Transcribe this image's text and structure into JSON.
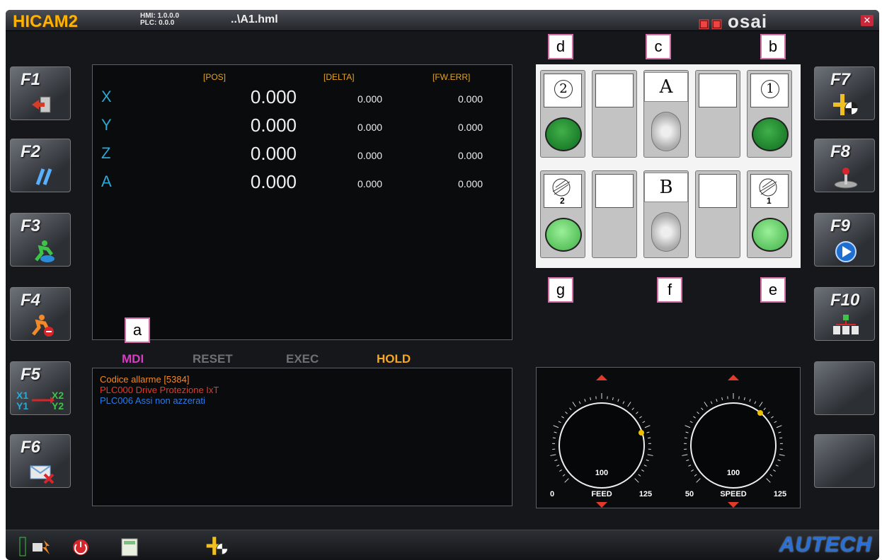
{
  "title_bar": {
    "logo": "HICAM2",
    "hmi_version": "HMI: 1.0.0.0",
    "plc_version": "PLC: 0.0.0",
    "file": "..\\A1.hml",
    "brand": "osai"
  },
  "function_keys": {
    "left": [
      {
        "label": "F1",
        "icon": "exit-door-icon"
      },
      {
        "label": "F2",
        "icon": "double-slash-icon"
      },
      {
        "label": "F3",
        "icon": "running-man-icon"
      },
      {
        "label": "F4",
        "icon": "running-man-stop-icon"
      },
      {
        "label": "F5",
        "icon": "axis-swap-icon"
      },
      {
        "label": "F6",
        "icon": "envelope-delete-icon"
      }
    ],
    "right": [
      {
        "label": "F7",
        "icon": "origin-target-icon"
      },
      {
        "label": "F8",
        "icon": "joystick-icon"
      },
      {
        "label": "F9",
        "icon": "play-icon"
      },
      {
        "label": "F10",
        "icon": "network-icon"
      }
    ]
  },
  "axes": {
    "headers": {
      "pos": "[POS]",
      "delta": "[DELTA]",
      "fw_err": "[FW.ERR]"
    },
    "rows": [
      {
        "name": "X",
        "pos": "0.000",
        "delta": "0.000",
        "fw_err": "0.000"
      },
      {
        "name": "Y",
        "pos": "0.000",
        "delta": "0.000",
        "fw_err": "0.000"
      },
      {
        "name": "Z",
        "pos": "0.000",
        "delta": "0.000",
        "fw_err": "0.000"
      },
      {
        "name": "A",
        "pos": "0.000",
        "delta": "0.000",
        "fw_err": "0.000"
      }
    ]
  },
  "modes": {
    "mdi": "MDI",
    "reset": "RESET",
    "exec": "EXEC",
    "hold": "HOLD",
    "colors": {
      "mdi": "#d63cc4",
      "reset": "#6e7075",
      "exec": "#6e7075",
      "hold": "#f5a623"
    }
  },
  "messages": [
    {
      "text": "Codice allarme [5384]",
      "color": "#f08a2a"
    },
    {
      "text": "PLC000  Drive  Protezione IxT",
      "color": "#e43a2a"
    },
    {
      "text": "PLC006  Assi non azzerati",
      "color": "#2c7be5"
    }
  ],
  "switch_panel": {
    "selector_top": "A",
    "selector_bottom": "B",
    "top_left_number": "2",
    "top_right_number": "1",
    "bottom_left_number": "2",
    "bottom_right_number": "1"
  },
  "annotation_tags": {
    "a": "a",
    "b": "b",
    "c": "c",
    "d": "d",
    "e": "e",
    "f": "f",
    "g": "g"
  },
  "overrides": {
    "feed": {
      "label": "FEED",
      "value": "100",
      "min": "0",
      "max": "125"
    },
    "speed": {
      "label": "SPEED",
      "value": "100",
      "min": "50",
      "max": "125"
    }
  },
  "status_bar": {
    "brand": "AUTECH"
  }
}
